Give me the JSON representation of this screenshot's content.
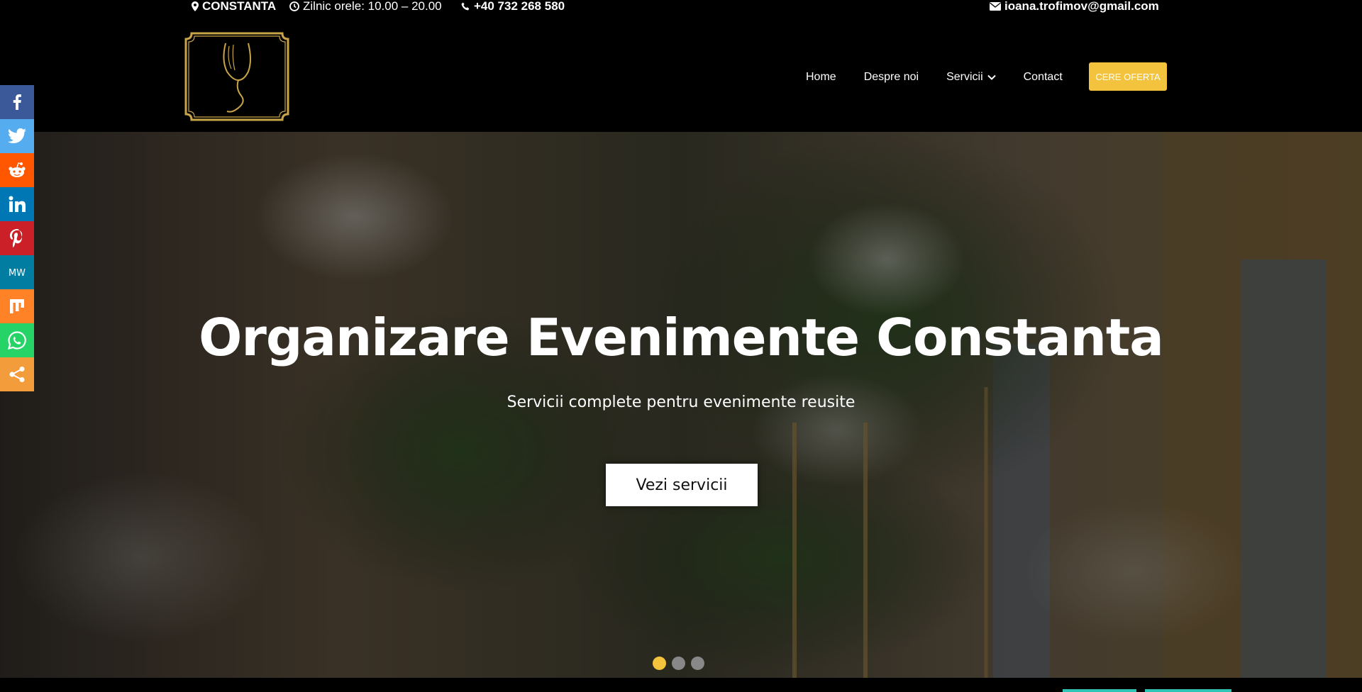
{
  "topbar": {
    "location": "CONSTANTA",
    "hours": "Zilnic orele: 10.00 – 20.00",
    "phone": "+40 732 268 580",
    "email": "ioana.trofimov@gmail.com"
  },
  "nav": {
    "home": "Home",
    "about": "Despre noi",
    "services": "Servicii",
    "contact": "Contact",
    "cta": "CERE OFERTA"
  },
  "hero": {
    "title": "Organizare Evenimente Constanta",
    "subtitle": "Servicii complete pentru evenimente reusite",
    "button": "Vezi servicii"
  },
  "slider": {
    "slides": 3,
    "active": 1
  },
  "social": [
    {
      "name": "facebook",
      "color": "#3b5998"
    },
    {
      "name": "twitter",
      "color": "#55acee"
    },
    {
      "name": "reddit",
      "color": "#ff5700"
    },
    {
      "name": "linkedin",
      "color": "#0077b5"
    },
    {
      "name": "pinterest",
      "color": "#cb2027"
    },
    {
      "name": "mewe",
      "color": "#007da1"
    },
    {
      "name": "mix",
      "color": "#ff8226"
    },
    {
      "name": "whatsapp",
      "color": "#25d366"
    },
    {
      "name": "share",
      "color": "#f39c3c"
    }
  ],
  "colors": {
    "accent": "#f3c33d",
    "logo_gold": "#c9a54a"
  }
}
